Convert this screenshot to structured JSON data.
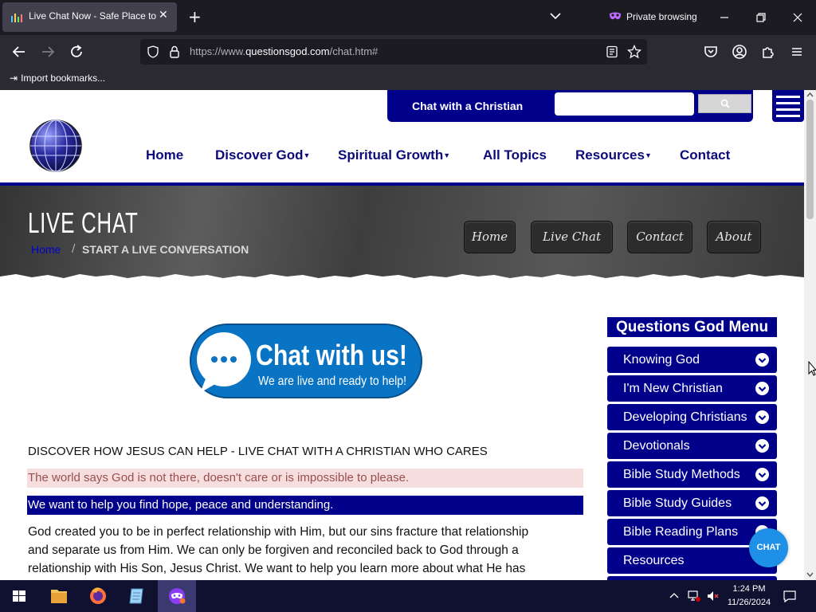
{
  "browser": {
    "tab_title": "Live Chat Now - Safe Place to t",
    "private_label": "Private browsing",
    "url_prefix": "https://www.",
    "url_domain": "questionsgod.com",
    "url_path": "/chat.htm#",
    "bookmark_label": "Import bookmarks..."
  },
  "site": {
    "chat_bar_title": "Chat with a Christian",
    "search_placeholder": "",
    "nav": [
      "Home",
      "Discover God",
      "Spiritual Growth",
      "All Topics",
      "Resources",
      "Contact"
    ],
    "banner_title": "LIVE CHAT",
    "breadcrumb_home": "Home",
    "breadcrumb_sep": "/",
    "breadcrumb_current": "START A LIVE CONVERSATION",
    "banner_buttons": [
      "Home",
      "Live Chat",
      "Contact",
      "About"
    ],
    "chat_image_title": "Chat with us!",
    "chat_image_sub": "We are live and ready to help!",
    "para1": "DISCOVER HOW JESUS CAN HELP - LIVE CHAT WITH A CHRISTIAN WHO CARES",
    "para2": "The world says God is not there, doesn't care or is impossible to please.",
    "para3": "We want to help you find hope, peace and understanding.",
    "para4_lines": [
      "God created you to be in perfect relationship with Him, but our sins fracture that relationship",
      "and separate us from Him. We can only be forgiven and reconciled back to God through a",
      "relationship with His Son, Jesus Christ. We want to help you learn more about what He has"
    ],
    "menu_title": "Questions God Menu",
    "menu_items": [
      "Knowing God",
      "I'm New Christian",
      "Developing Christians",
      "Devotionals",
      "Bible Study Methods",
      "Bible Study Guides",
      "Bible Reading Plans",
      "Resources"
    ],
    "chat_bubble": "CHAT"
  },
  "taskbar": {
    "time": "1:24 PM",
    "date": "11/26/2024"
  },
  "colors": {
    "brand_navy": "#00008b",
    "nav_text": "#0b0b7a",
    "chat_blue": "#1e90e8"
  }
}
